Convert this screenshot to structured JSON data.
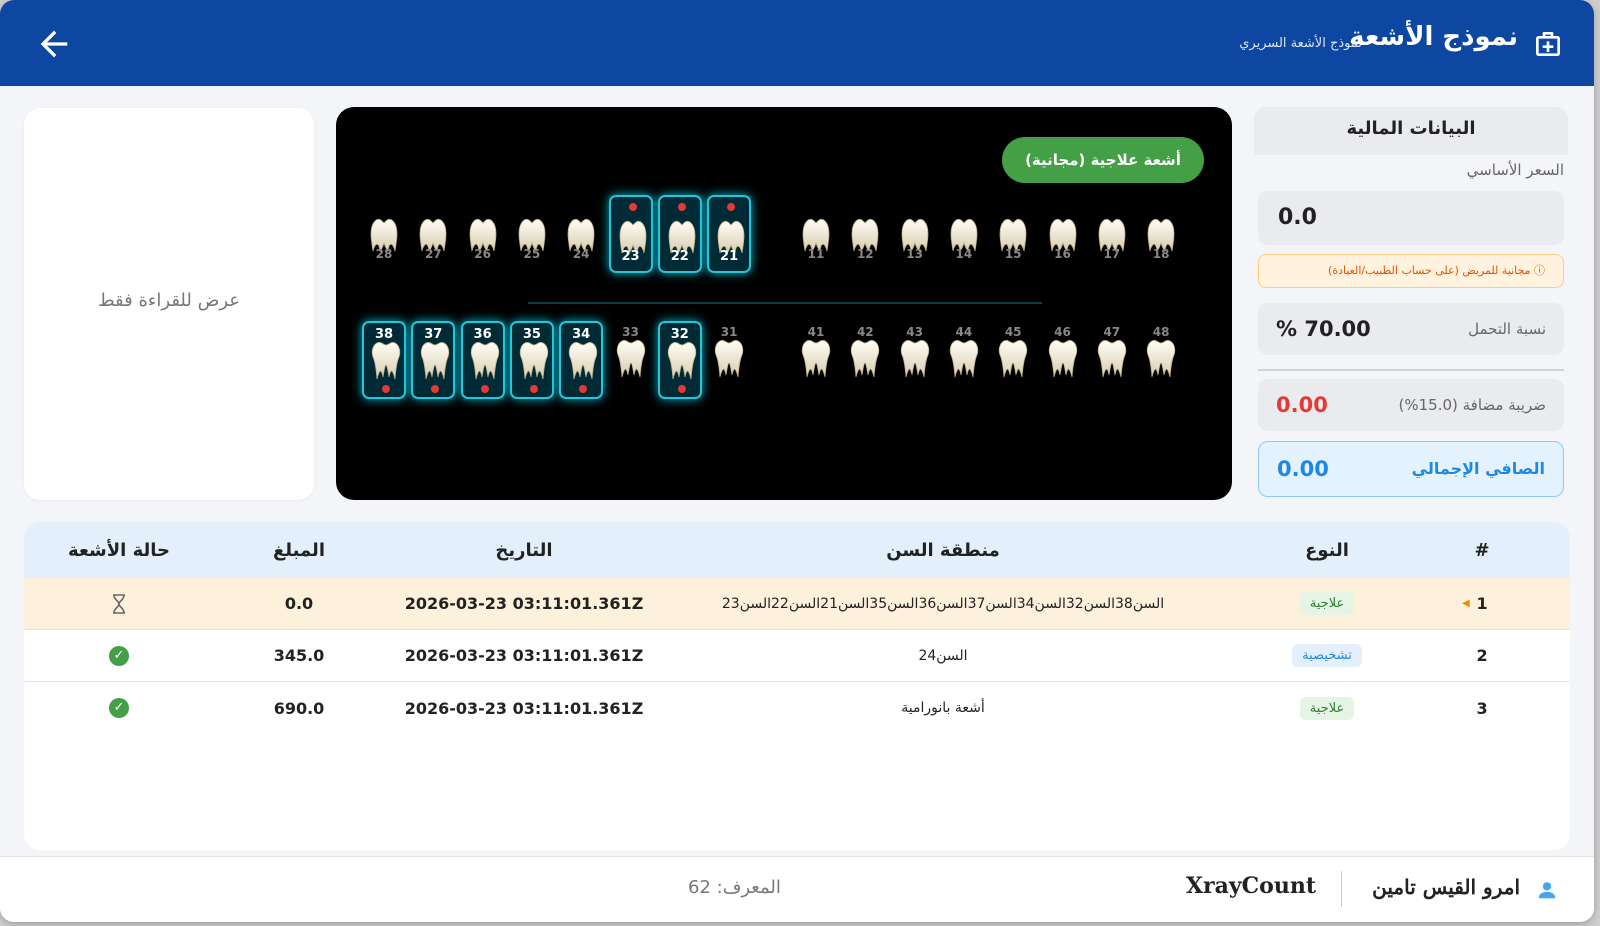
{
  "header": {
    "title": "نموذج الأشعة",
    "subtitle": "نموذج الأشعة السريري"
  },
  "readonly_panel": {
    "text": "عرض للقراءة فقط"
  },
  "dental_chart": {
    "badge": "أشعة علاجية (مجانية)",
    "upper_left": [
      {
        "num": "28",
        "selected": false
      },
      {
        "num": "27",
        "selected": false
      },
      {
        "num": "26",
        "selected": false
      },
      {
        "num": "25",
        "selected": false
      },
      {
        "num": "24",
        "selected": false
      },
      {
        "num": "23",
        "selected": true
      },
      {
        "num": "22",
        "selected": true
      },
      {
        "num": "21",
        "selected": true
      }
    ],
    "upper_right": [
      {
        "num": "11",
        "selected": false
      },
      {
        "num": "12",
        "selected": false
      },
      {
        "num": "13",
        "selected": false
      },
      {
        "num": "14",
        "selected": false
      },
      {
        "num": "15",
        "selected": false
      },
      {
        "num": "16",
        "selected": false
      },
      {
        "num": "17",
        "selected": false
      },
      {
        "num": "18",
        "selected": false
      }
    ],
    "lower_left": [
      {
        "num": "38",
        "selected": true
      },
      {
        "num": "37",
        "selected": true
      },
      {
        "num": "36",
        "selected": true
      },
      {
        "num": "35",
        "selected": true
      },
      {
        "num": "34",
        "selected": true
      },
      {
        "num": "33",
        "selected": false
      },
      {
        "num": "32",
        "selected": true
      },
      {
        "num": "31",
        "selected": false
      }
    ],
    "lower_right": [
      {
        "num": "41",
        "selected": false
      },
      {
        "num": "42",
        "selected": false
      },
      {
        "num": "43",
        "selected": false
      },
      {
        "num": "44",
        "selected": false
      },
      {
        "num": "45",
        "selected": false
      },
      {
        "num": "46",
        "selected": false
      },
      {
        "num": "47",
        "selected": false
      },
      {
        "num": "48",
        "selected": false
      }
    ]
  },
  "finance": {
    "title": "البيانات المالية",
    "base_price_label": "السعر الأساسي",
    "base_price": "0.0",
    "free_note": "مجانية للمريض (على حساب الطبيب/العيادة)",
    "coverage_label": "نسبة التحمل",
    "coverage_value": "% 70.00",
    "tax_label": "ضريبة مضافة (15.0%)",
    "tax_value": "0.00",
    "net_label": "الصافي الإجمالي",
    "net_value": "0.00"
  },
  "table": {
    "headers": {
      "num": "#",
      "type": "النوع",
      "tooth": "منطقة السن",
      "date": "التاريخ",
      "amount": "المبلغ",
      "status": "حالة الأشعة"
    },
    "rows": [
      {
        "num": "1",
        "type": "علاجية",
        "type_kind": "t",
        "tooth": "السن38السن32السن34السن37السن36السن35السن21السن22السن23",
        "date": "2026-03-23 03:11:01.361Z",
        "amount": "0.0",
        "status": "pending"
      },
      {
        "num": "2",
        "type": "تشخيصية",
        "type_kind": "d",
        "tooth": "السن24",
        "date": "2026-03-23 03:11:01.361Z",
        "amount": "345.0",
        "status": "done"
      },
      {
        "num": "3",
        "type": "علاجية",
        "type_kind": "t",
        "tooth": "أشعة بانورامية",
        "date": "2026-03-23 03:11:01.361Z",
        "amount": "690.0",
        "status": "done"
      }
    ]
  },
  "footer": {
    "patient_name": "امرو القيس تامين",
    "title": "XrayCount",
    "id_label": "المعرف: 62"
  },
  "colors": {
    "header": "#0d47a1",
    "badge": "#43a047",
    "tax": "#e53935",
    "net": "#1e88e5"
  }
}
